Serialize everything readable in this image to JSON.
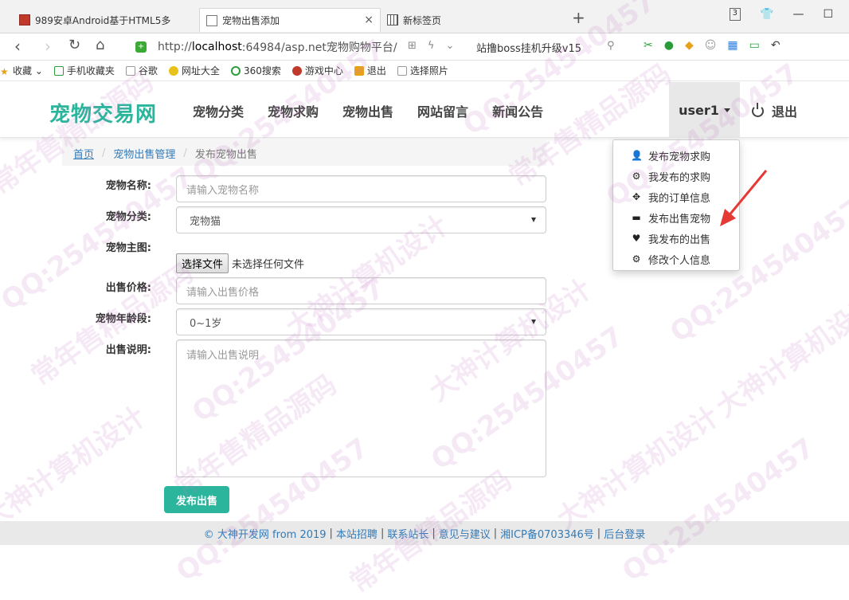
{
  "browser": {
    "tabs": [
      {
        "title": "989安卓Android基于HTML5多"
      },
      {
        "title": "宠物出售添加",
        "close": "×"
      },
      {
        "title": "新标签页"
      }
    ],
    "new_tab": "+",
    "window_badge": "3",
    "url_prefix": "http://",
    "url_host": "localhost",
    "url_rest": ":64984/asp.net宠物购物平台/",
    "search_text": "站撸boss挂机升级v15",
    "bookmarks": [
      "收藏",
      "手机收藏夹",
      "谷歌",
      "网址大全",
      "360搜索",
      "游戏中心",
      "退出",
      "选择照片"
    ]
  },
  "site": {
    "brand": "宠物交易网",
    "nav": [
      "宠物分类",
      "宠物求购",
      "宠物出售",
      "网站留言",
      "新闻公告"
    ],
    "user": "user1",
    "logout": "退出"
  },
  "breadcrumb": {
    "home": "首页",
    "section": "宠物出售管理",
    "current": "发布宠物出售"
  },
  "form": {
    "name_label": "宠物名称:",
    "name_placeholder": "请输入宠物名称",
    "category_label": "宠物分类:",
    "category_value": "宠物猫",
    "image_label": "宠物主图:",
    "file_button": "选择文件",
    "file_status": "未选择任何文件",
    "price_label": "出售价格:",
    "price_placeholder": "请输入出售价格",
    "age_label": "宠物年龄段:",
    "age_value": "0~1岁",
    "desc_label": "出售说明:",
    "desc_placeholder": "请输入出售说明",
    "submit": "发布出售"
  },
  "dropdown": [
    {
      "icon": "user-icon",
      "label": "发布宠物求购"
    },
    {
      "icon": "gear-icon",
      "label": "我发布的求购"
    },
    {
      "icon": "move-icon",
      "label": "我的订单信息"
    },
    {
      "icon": "card-icon",
      "label": "发布出售宠物"
    },
    {
      "icon": "heart-icon",
      "label": "我发布的出售"
    },
    {
      "icon": "gear-icon",
      "label": "修改个人信息"
    }
  ],
  "footer": {
    "copyright": "© 大神开发网 from 2019",
    "links": [
      "本站招聘",
      "联系站长",
      "意见与建议",
      "湘ICP备0703346号",
      "后台登录"
    ]
  },
  "watermarks": [
    "QQ:254540457",
    "常年售精品源码",
    "大神计算机设计"
  ],
  "colors": {
    "brand": "#2ab59c",
    "link": "#337ab7"
  }
}
